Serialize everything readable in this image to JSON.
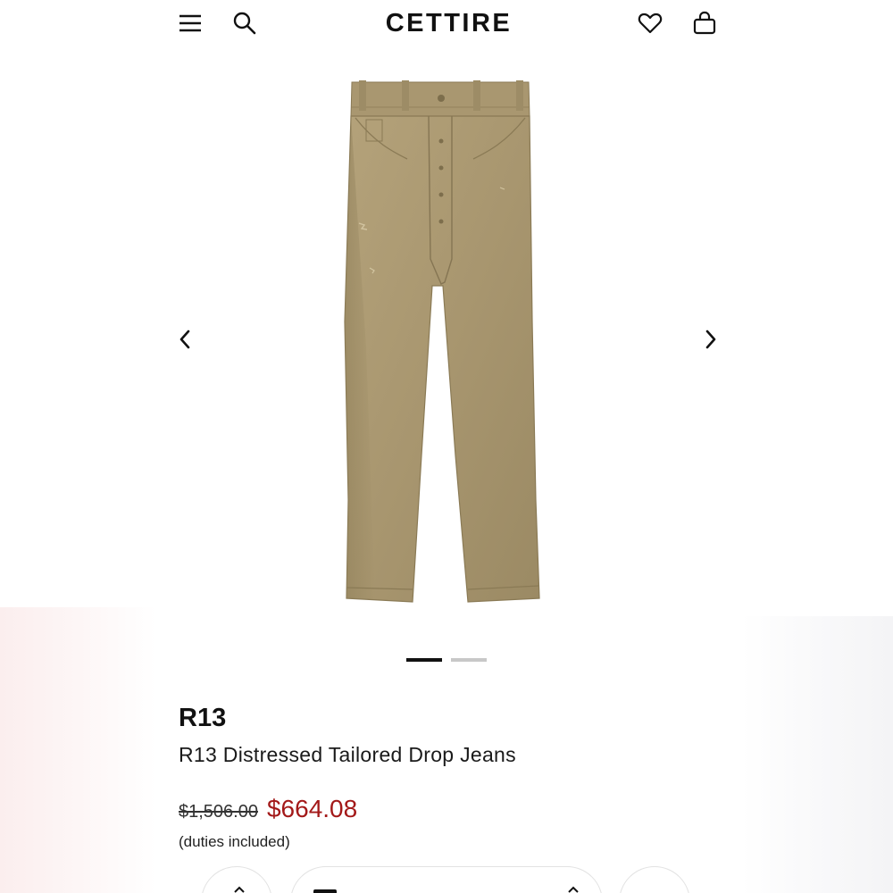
{
  "header": {
    "logo": "CETTIRE",
    "menu_icon": "menu-icon",
    "search_icon": "search-icon",
    "wishlist_icon": "heart-icon",
    "cart_icon": "shopping-bag-icon"
  },
  "carousel": {
    "image": "product-jeans-image",
    "prev_icon": "chevron-left-icon",
    "next_icon": "chevron-right-icon",
    "slide_count": 2,
    "active_slide": 1
  },
  "product": {
    "brand": "R13",
    "name": "R13 Distressed Tailored Drop Jeans",
    "original_price": "$1,506.00",
    "sale_price": "$664.08",
    "duties_note": "(duties included)"
  },
  "colors": {
    "sale_price": "#a31919",
    "text": "#111111",
    "denim": "#a89670"
  }
}
